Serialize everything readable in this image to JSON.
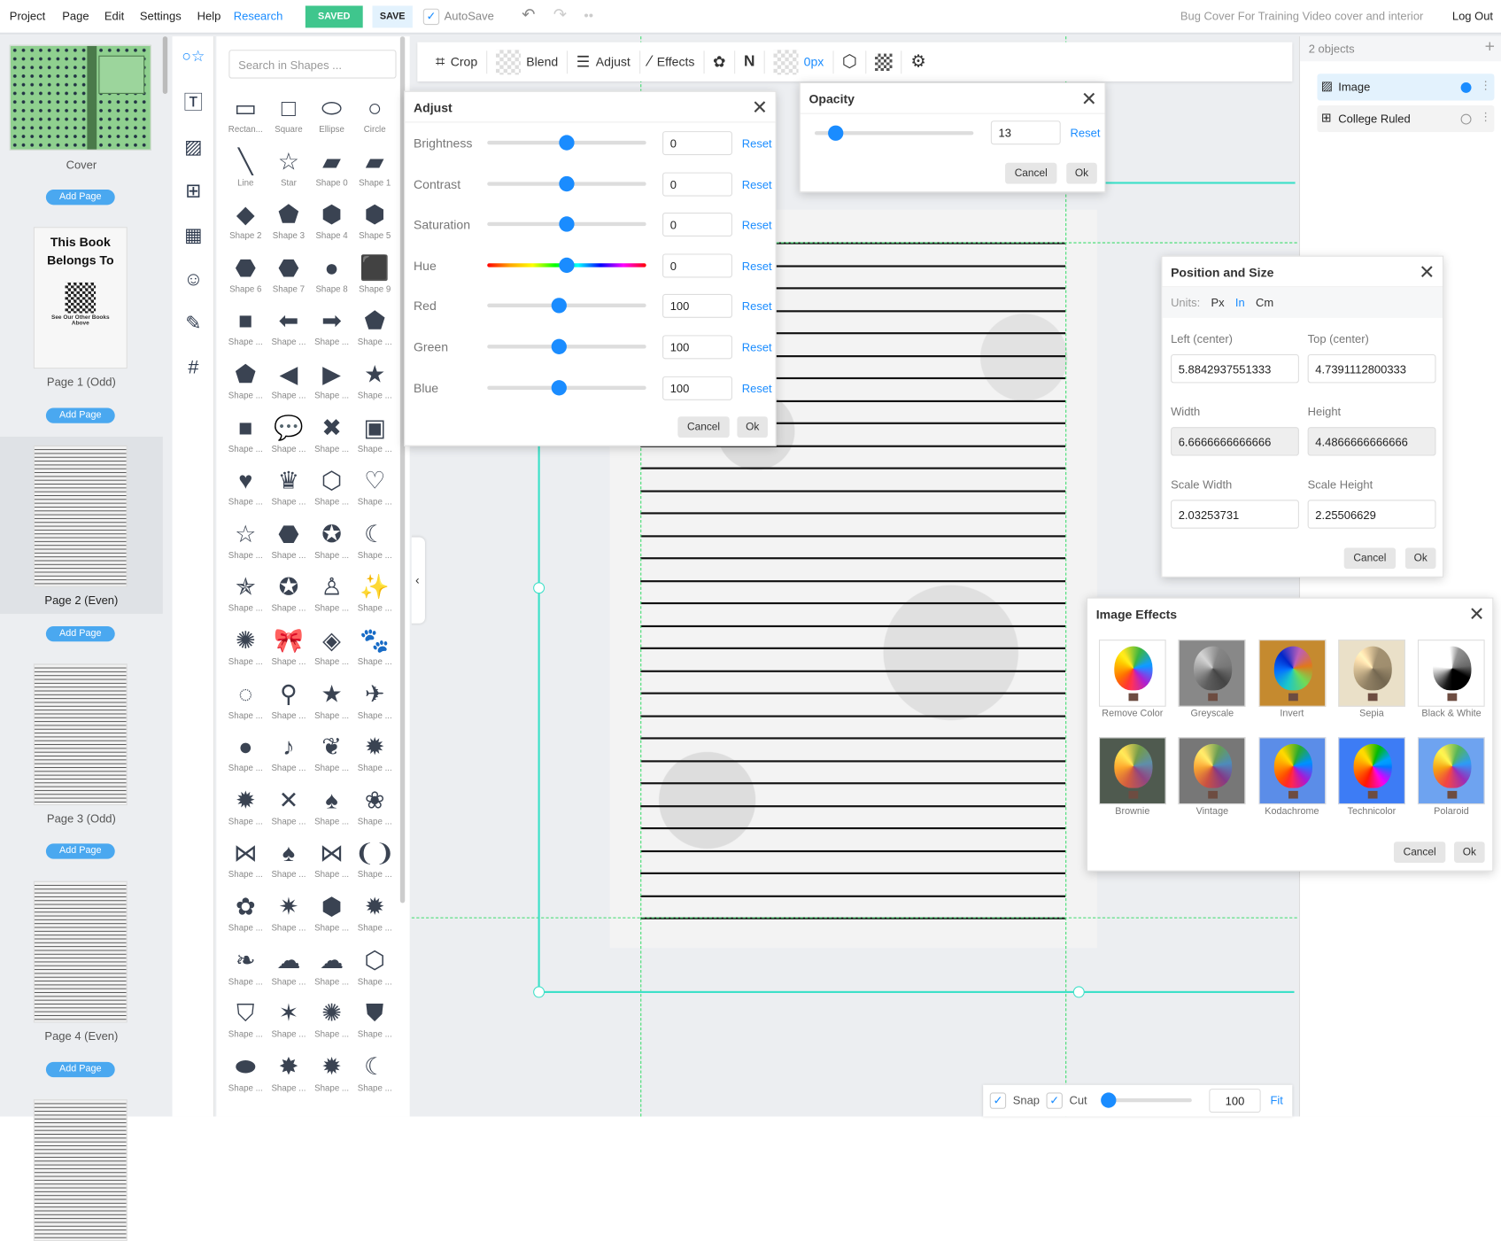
{
  "menu": {
    "items": [
      "Project",
      "Page",
      "Edit",
      "Settings",
      "Help"
    ],
    "research": "Research",
    "saved": "SAVED",
    "save": "SAVE",
    "autosave": "AutoSave",
    "doc_title": "Bug Cover For Training Video cover and interior",
    "logout": "Log Out"
  },
  "pages": [
    {
      "label": "Cover",
      "add": "Add Page"
    },
    {
      "label": "Page 1 (Odd)",
      "add": "Add Page",
      "title": "This Book Belongs To",
      "note": "See Our Other Books Above"
    },
    {
      "label": "Page 2 (Even)",
      "add": "Add Page"
    },
    {
      "label": "Page 3 (Odd)",
      "add": "Add Page"
    },
    {
      "label": "Page 4 (Even)",
      "add": "Add Page"
    }
  ],
  "sidebar_icons": [
    "shapes-icon",
    "text-icon",
    "image-icon",
    "layout-icon",
    "pattern-icon",
    "mask-icon",
    "brush-icon",
    "grid-icon"
  ],
  "shapes": {
    "search_placeholder": "Search in Shapes ...",
    "items": [
      {
        "l": "Rectan...",
        "g": "▭"
      },
      {
        "l": "Square",
        "g": "□"
      },
      {
        "l": "Ellipse",
        "g": "⬭"
      },
      {
        "l": "Circle",
        "g": "○"
      },
      {
        "l": "Line",
        "g": "╲"
      },
      {
        "l": "Star",
        "g": "☆"
      },
      {
        "l": "Shape 0",
        "g": "▰"
      },
      {
        "l": "Shape 1",
        "g": "▰"
      },
      {
        "l": "Shape 2",
        "g": "◆"
      },
      {
        "l": "Shape 3",
        "g": "⬟"
      },
      {
        "l": "Shape 4",
        "g": "⬢"
      },
      {
        "l": "Shape 5",
        "g": "⬢"
      },
      {
        "l": "Shape 6",
        "g": "⬣"
      },
      {
        "l": "Shape 7",
        "g": "⬣"
      },
      {
        "l": "Shape 8",
        "g": "●"
      },
      {
        "l": "Shape 9",
        "g": "⬛"
      },
      {
        "l": "Shape ...",
        "g": "■"
      },
      {
        "l": "Shape ...",
        "g": "⬅"
      },
      {
        "l": "Shape ...",
        "g": "➡"
      },
      {
        "l": "Shape ...",
        "g": "⬟"
      },
      {
        "l": "Shape ...",
        "g": "⬟"
      },
      {
        "l": "Shape ...",
        "g": "◀"
      },
      {
        "l": "Shape ...",
        "g": "▶"
      },
      {
        "l": "Shape ...",
        "g": "★"
      },
      {
        "l": "Shape ...",
        "g": "■"
      },
      {
        "l": "Shape ...",
        "g": "💬"
      },
      {
        "l": "Shape ...",
        "g": "✖"
      },
      {
        "l": "Shape ...",
        "g": "▣"
      },
      {
        "l": "Shape ...",
        "g": "♥"
      },
      {
        "l": "Shape ...",
        "g": "♛"
      },
      {
        "l": "Shape ...",
        "g": "⬡"
      },
      {
        "l": "Shape ...",
        "g": "♡"
      },
      {
        "l": "Shape ...",
        "g": "☆"
      },
      {
        "l": "Shape ...",
        "g": "⬣"
      },
      {
        "l": "Shape ...",
        "g": "✪"
      },
      {
        "l": "Shape ...",
        "g": "☾"
      },
      {
        "l": "Shape ...",
        "g": "✯"
      },
      {
        "l": "Shape ...",
        "g": "✪"
      },
      {
        "l": "Shape ...",
        "g": "♙"
      },
      {
        "l": "Shape ...",
        "g": "✨"
      },
      {
        "l": "Shape ...",
        "g": "✺"
      },
      {
        "l": "Shape ...",
        "g": "🎀"
      },
      {
        "l": "Shape ...",
        "g": "◈"
      },
      {
        "l": "Shape ...",
        "g": "🐾"
      },
      {
        "l": "Shape ...",
        "g": "◌"
      },
      {
        "l": "Shape ...",
        "g": "⚲"
      },
      {
        "l": "Shape ...",
        "g": "★"
      },
      {
        "l": "Shape ...",
        "g": "✈"
      },
      {
        "l": "Shape ...",
        "g": "●"
      },
      {
        "l": "Shape ...",
        "g": "♪"
      },
      {
        "l": "Shape ...",
        "g": "❦"
      },
      {
        "l": "Shape ...",
        "g": "✹"
      },
      {
        "l": "Shape ...",
        "g": "✹"
      },
      {
        "l": "Shape ...",
        "g": "✕"
      },
      {
        "l": "Shape ...",
        "g": "♠"
      },
      {
        "l": "Shape ...",
        "g": "❀"
      },
      {
        "l": "Shape ...",
        "g": "⋈"
      },
      {
        "l": "Shape ...",
        "g": "♠"
      },
      {
        "l": "Shape ...",
        "g": "⋈"
      },
      {
        "l": "Shape ...",
        "g": "❨❩"
      },
      {
        "l": "Shape ...",
        "g": "✿"
      },
      {
        "l": "Shape ...",
        "g": "✷"
      },
      {
        "l": "Shape ...",
        "g": "⬢"
      },
      {
        "l": "Shape ...",
        "g": "✹"
      },
      {
        "l": "Shape ...",
        "g": "❧"
      },
      {
        "l": "Shape ...",
        "g": "☁"
      },
      {
        "l": "Shape ...",
        "g": "☁"
      },
      {
        "l": "Shape ...",
        "g": "⬡"
      },
      {
        "l": "Shape ...",
        "g": "⛉"
      },
      {
        "l": "Shape ...",
        "g": "✶"
      },
      {
        "l": "Shape ...",
        "g": "✺"
      },
      {
        "l": "Shape ...",
        "g": "⛊"
      },
      {
        "l": "Shape ...",
        "g": "⬬"
      },
      {
        "l": "Shape ...",
        "g": "✸"
      },
      {
        "l": "Shape ...",
        "g": "✹"
      },
      {
        "l": "Shape ...",
        "g": "☾"
      }
    ]
  },
  "toolbar": {
    "crop": "Crop",
    "blend": "Blend",
    "adjust": "Adjust",
    "effects": "Effects",
    "border": "0px"
  },
  "adjust": {
    "title": "Adjust",
    "reset": "Reset",
    "cancel": "Cancel",
    "ok": "Ok",
    "rows": [
      {
        "label": "Brightness",
        "value": "0",
        "pos": 0.5
      },
      {
        "label": "Contrast",
        "value": "0",
        "pos": 0.5
      },
      {
        "label": "Saturation",
        "value": "0",
        "pos": 0.5
      },
      {
        "label": "Hue",
        "value": "0",
        "pos": 0.5
      },
      {
        "label": "Red",
        "value": "100",
        "pos": 0.45
      },
      {
        "label": "Green",
        "value": "100",
        "pos": 0.45
      },
      {
        "label": "Blue",
        "value": "100",
        "pos": 0.45
      }
    ]
  },
  "opacity": {
    "title": "Opacity",
    "value": "13",
    "pos": 0.13,
    "reset": "Reset",
    "cancel": "Cancel",
    "ok": "Ok"
  },
  "objects": {
    "count": "2 objects",
    "items": [
      {
        "label": "Image",
        "selected": true
      },
      {
        "label": "College Ruled",
        "selected": false
      }
    ]
  },
  "position": {
    "title": "Position and Size",
    "units_label": "Units:",
    "units": [
      "Px",
      "In",
      "Cm"
    ],
    "active_unit": "In",
    "left_label": "Left (center)",
    "left": "5.8842937551333",
    "top_label": "Top (center)",
    "top": "4.7391112800333",
    "width_label": "Width",
    "width": "6.6666666666666",
    "height_label": "Height",
    "height": "4.4866666666666",
    "sw_label": "Scale Width",
    "sw": "2.03253731",
    "sh_label": "Scale Height",
    "sh": "2.25506629",
    "cancel": "Cancel",
    "ok": "Ok"
  },
  "effects": {
    "title": "Image Effects",
    "cancel": "Cancel",
    "ok": "Ok",
    "items": [
      "Remove Color",
      "Greyscale",
      "Invert",
      "Sepia",
      "Black & White",
      "Brownie",
      "Vintage",
      "Kodachrome",
      "Technicolor",
      "Polaroid"
    ]
  },
  "bottom": {
    "snap": "Snap",
    "cut": "Cut",
    "zoom": "100",
    "zoom_pos": 0.0,
    "fit": "Fit"
  },
  "colors": {
    "accent": "#1a8cff",
    "saved": "#3fc68d",
    "guide": "#3ddc6d",
    "selection": "#3de0c8"
  }
}
